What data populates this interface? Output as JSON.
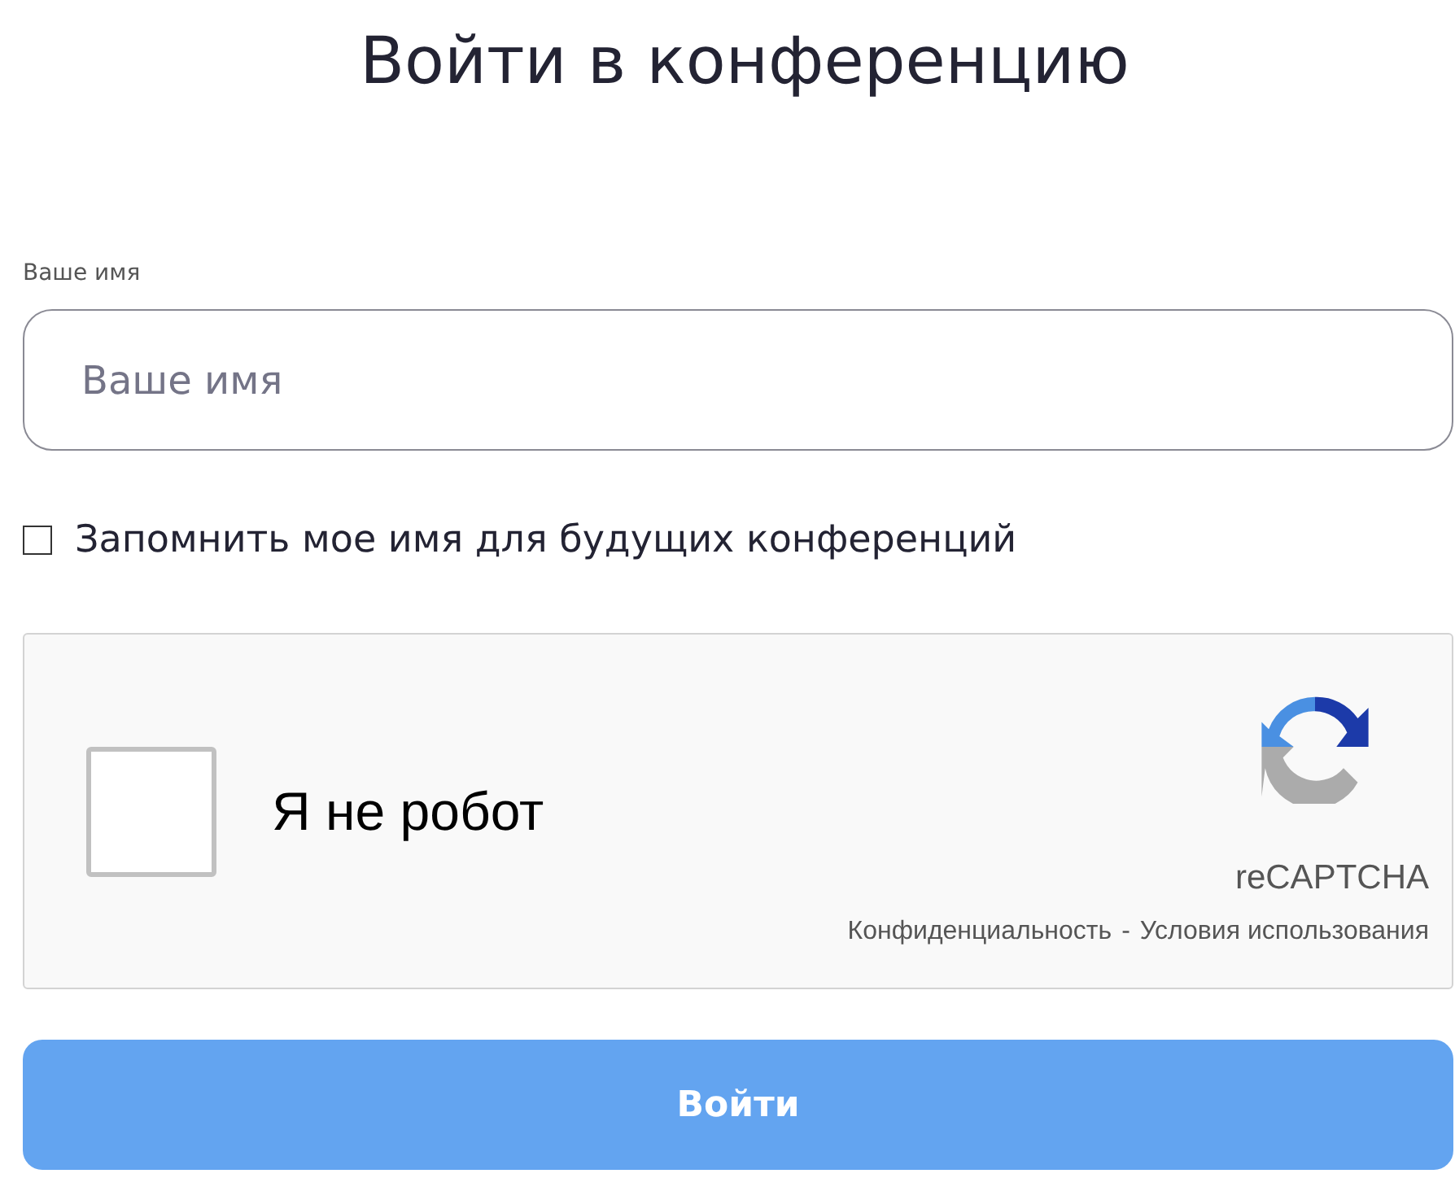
{
  "title": "Войти в конференцию",
  "name_field": {
    "label": "Ваше имя",
    "placeholder": "Ваше имя"
  },
  "remember": {
    "label": "Запомнить мое имя для будущих конференций",
    "checked": false
  },
  "captcha": {
    "label": "Я не робот",
    "checked": false,
    "brand": "reCAPTCHA",
    "privacy": "Конфиденциальность",
    "separator": "-",
    "terms": "Условия использования"
  },
  "submit": {
    "label": "Войти",
    "disabled": true
  }
}
